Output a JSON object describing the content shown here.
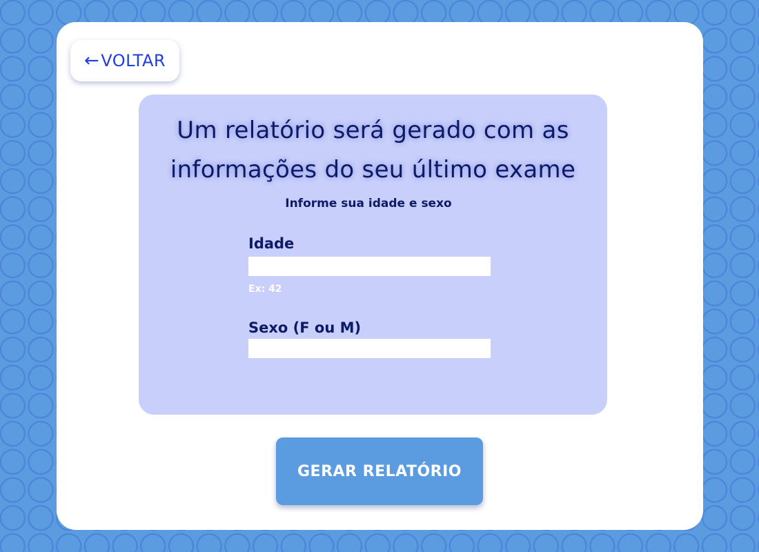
{
  "colors": {
    "page_background": "#5b9bdf",
    "card_background": "#ffffff",
    "panel_background": "#c8cffa",
    "title_text": "#0d1a66",
    "back_button_text": "#1f3ee0",
    "primary_button": "#5b9bdf",
    "hint_text": "#ffffff"
  },
  "back_button": {
    "icon": "arrow-left-icon",
    "arrow_glyph": "←",
    "label": "VOLTAR"
  },
  "panel": {
    "title": "Um relatório será gerado com as informações do seu último exame",
    "subtitle": "Informe sua idade e sexo"
  },
  "form": {
    "age": {
      "label": "Idade",
      "value": "",
      "hint": "Ex: 42"
    },
    "sex": {
      "label": "Sexo (F ou M)",
      "value": ""
    }
  },
  "generate_button": {
    "label": "GERAR RELATÓRIO"
  }
}
